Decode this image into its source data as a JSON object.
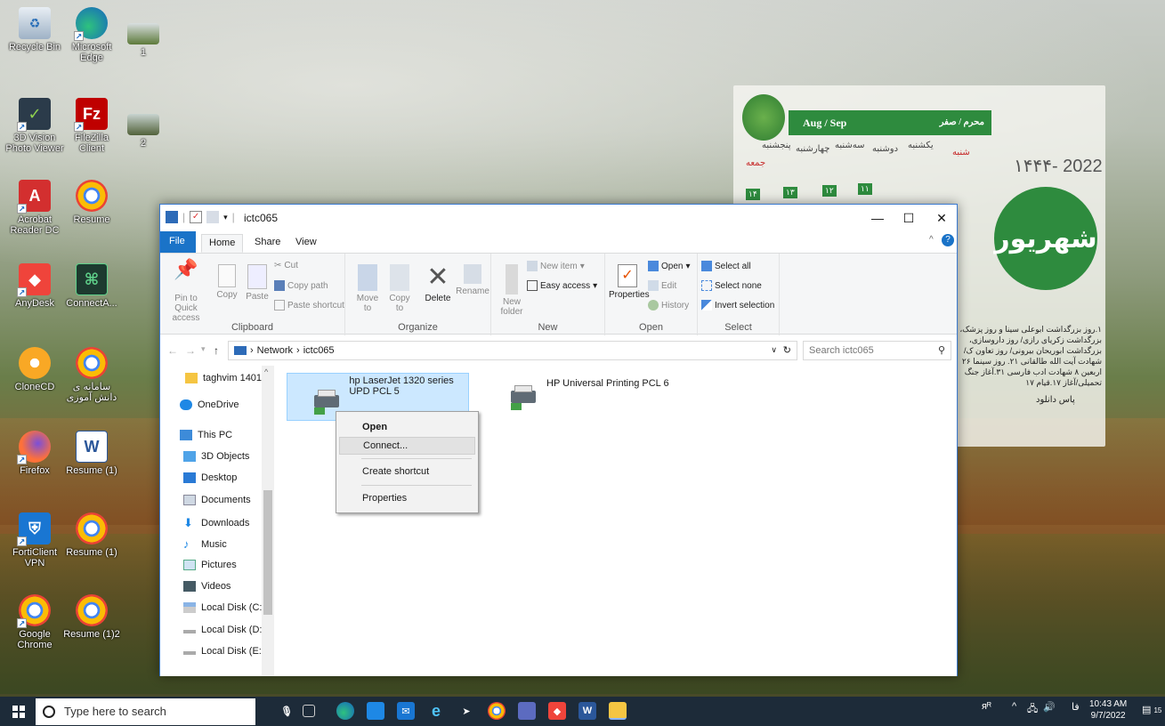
{
  "desktop": {
    "icons": [
      {
        "label": "Recycle Bin"
      },
      {
        "label": "Microsoft Edge"
      },
      {
        "label": "1"
      },
      {
        "label": "3D Vision Photo Viewer"
      },
      {
        "label": "FileZilla Client"
      },
      {
        "label": "2"
      },
      {
        "label": "Acrobat Reader DC"
      },
      {
        "label": "Resume"
      },
      {
        "label": "AnyDesk"
      },
      {
        "label": "ConnectA..."
      },
      {
        "label": "CloneCD"
      },
      {
        "label": "سامانه ی دانش آموزی"
      },
      {
        "label": "Firefox"
      },
      {
        "label": "Resume (1)"
      },
      {
        "label": "FortiClient VPN"
      },
      {
        "label": "Resume (1)"
      },
      {
        "label": "Google Chrome"
      },
      {
        "label": "Resume (1)2"
      }
    ]
  },
  "calendar": {
    "header_left": "Aug / Sep",
    "header_right": "محرم / صفر",
    "year": "۱۴۴۴- 2022",
    "month": "شهریور",
    "days": [
      "شنبه",
      "یکشنبه",
      "دوشنبه",
      "سه‌شنبه",
      "چهارشنبه",
      "پنجشنبه",
      "جمعه"
    ],
    "events": "۱.روز بزرگداشت ابوعلی سینا و روز پزشک، بزرگداشت زکریای رازی/ روز داروسازی، بزرگداشت ابوریحان بیرونی/ روز تعاون ک/شهادت آیت الله طالقانی ۲۱. روز سینما ۲۶ اربعین ۸ شهادت ادب فارسی ۳۱.آغاز جنگ تحمیلی/آغاز ۱۷.قیام ۱۷",
    "brand": "پاس دانلود"
  },
  "window": {
    "title": "ictc065",
    "controls": {
      "minimize": "—",
      "maximize": "☐",
      "close": "✕"
    },
    "tabs": {
      "file": "File",
      "home": "Home",
      "share": "Share",
      "view": "View"
    },
    "ribbon": {
      "clipboard": {
        "label": "Clipboard",
        "pin": "Pin to Quick access",
        "copy": "Copy",
        "paste": "Paste",
        "cut": "Cut",
        "copy_path": "Copy path",
        "paste_shortcut": "Paste shortcut"
      },
      "organize": {
        "label": "Organize",
        "move_to": "Move to",
        "copy_to": "Copy to",
        "delete": "Delete",
        "rename": "Rename"
      },
      "new": {
        "label": "New",
        "new_folder": "New folder",
        "new_item": "New item",
        "easy_access": "Easy access"
      },
      "open": {
        "label": "Open",
        "properties": "Properties",
        "open": "Open",
        "edit": "Edit",
        "history": "History"
      },
      "select": {
        "label": "Select",
        "select_all": "Select all",
        "select_none": "Select none",
        "invert": "Invert selection"
      }
    },
    "address": {
      "crumbs": [
        "Network",
        "ictc065"
      ],
      "search_placeholder": "Search ictc065"
    },
    "nav": [
      {
        "label": "taghvim 1401"
      },
      {
        "label": "OneDrive"
      },
      {
        "label": "This PC"
      },
      {
        "label": "3D Objects"
      },
      {
        "label": "Desktop"
      },
      {
        "label": "Documents"
      },
      {
        "label": "Downloads"
      },
      {
        "label": "Music"
      },
      {
        "label": "Pictures"
      },
      {
        "label": "Videos"
      },
      {
        "label": "Local Disk (C:)"
      },
      {
        "label": "Local Disk (D:)"
      },
      {
        "label": "Local Disk (E:)"
      }
    ],
    "items": [
      {
        "label": "hp LaserJet 1320 series UPD PCL 5"
      },
      {
        "label": "HP Universal Printing PCL 6"
      }
    ],
    "context_menu": {
      "open": "Open",
      "connect": "Connect...",
      "create_shortcut": "Create shortcut",
      "properties": "Properties"
    }
  },
  "taskbar": {
    "search_placeholder": "Type here to search",
    "time": "10:43 AM",
    "date": "9/7/2022",
    "lang": "فا",
    "notif_count": "15"
  },
  "colors": {
    "accent": "#1a73c8",
    "selection": "#cce8ff",
    "calendar_green": "#2e8b3e",
    "taskbar": "#1d2b39"
  }
}
